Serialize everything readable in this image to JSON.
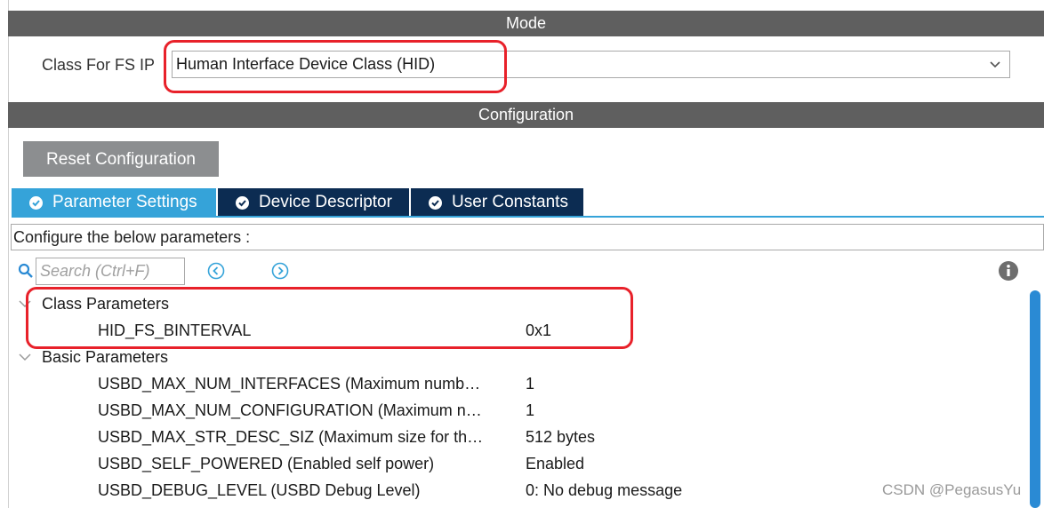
{
  "mode_section": {
    "title": "Mode",
    "class_label": "Class For FS IP",
    "class_value": "Human Interface Device Class (HID)"
  },
  "config_section": {
    "title": "Configuration",
    "reset_label": "Reset Configuration",
    "tabs": [
      {
        "label": "Parameter Settings",
        "active": true
      },
      {
        "label": "Device Descriptor",
        "active": false
      },
      {
        "label": "User Constants",
        "active": false
      }
    ],
    "info_text": "Configure the below parameters :",
    "search_placeholder": "Search (Ctrl+F)"
  },
  "groups": [
    {
      "label": "Class Parameters",
      "params": [
        {
          "name": "HID_FS_BINTERVAL",
          "value": "0x1"
        }
      ]
    },
    {
      "label": "Basic Parameters",
      "params": [
        {
          "name": "USBD_MAX_NUM_INTERFACES (Maximum numb…",
          "value": "1"
        },
        {
          "name": "USBD_MAX_NUM_CONFIGURATION (Maximum n…",
          "value": "1"
        },
        {
          "name": "USBD_MAX_STR_DESC_SIZ (Maximum size for th…",
          "value": "512 bytes"
        },
        {
          "name": "USBD_SELF_POWERED (Enabled self power)",
          "value": "Enabled"
        },
        {
          "name": "USBD_DEBUG_LEVEL (USBD Debug Level)",
          "value": "0: No debug message"
        }
      ]
    }
  ],
  "watermark": "CSDN @PegasusYu",
  "colors": {
    "section_bar": "#5f5f5f",
    "tab_active": "#35a3d9",
    "tab_inactive": "#0c2c52",
    "button": "#8c8e90",
    "highlight_ring": "#e8212a",
    "scrollbar": "#2a8ad4"
  }
}
